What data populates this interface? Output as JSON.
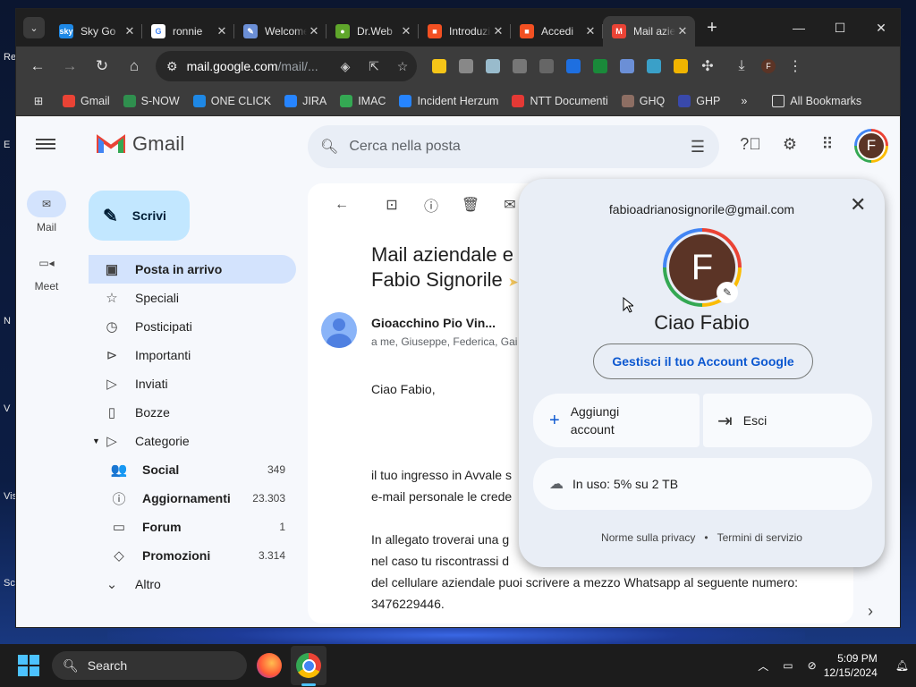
{
  "desktop": {
    "labels": [
      "Re",
      "E",
      "N",
      "V",
      "Vis",
      "Sc"
    ]
  },
  "browser": {
    "tabs": [
      {
        "title": "Sky Go",
        "fav_color": "#1e88e5",
        "fav_text": "sky"
      },
      {
        "title": "ronnie",
        "fav_color": "#ffffff",
        "fav_text": "G"
      },
      {
        "title": "Welcome",
        "fav_color": "#6b8fd6",
        "fav_text": "✎"
      },
      {
        "title": "Dr.Web",
        "fav_color": "#5fa62b",
        "fav_text": "●"
      },
      {
        "title": "Introduzione",
        "fav_color": "#f25022",
        "fav_text": "■"
      },
      {
        "title": "Accedi",
        "fav_color": "#f25022",
        "fav_text": "■"
      },
      {
        "title": "Mail aziendale",
        "fav_color": "#ea4335",
        "fav_text": "M"
      }
    ],
    "new_tab": "+",
    "url_host": "mail.google.com",
    "url_path": "/mail/...",
    "bookmarks": [
      {
        "label": "Gmail",
        "color": "#ea4335"
      },
      {
        "label": "S-NOW",
        "color": "#2f8f4e"
      },
      {
        "label": "ONE CLICK",
        "color": "#1e88e5"
      },
      {
        "label": "JIRA",
        "color": "#2684ff"
      },
      {
        "label": "IMAC",
        "color": "#34a853"
      },
      {
        "label": "Incident Herzum",
        "color": "#2684ff"
      },
      {
        "label": "NTT Documenti",
        "color": "#e53935"
      },
      {
        "label": "GHQ",
        "color": "#8d6e63"
      },
      {
        "label": "GHP",
        "color": "#3949ab"
      }
    ],
    "bookmarks_more": "»",
    "all_bookmarks": "All Bookmarks"
  },
  "gmail": {
    "logo_text": "Gmail",
    "search_placeholder": "Cerca nella posta",
    "avatar_letter": "F",
    "rail": [
      {
        "label": "Mail"
      },
      {
        "label": "Meet"
      }
    ],
    "compose": "Scrivi",
    "nav": [
      {
        "label": "Posta in arrivo",
        "icon": "▣"
      },
      {
        "label": "Speciali",
        "icon": "☆"
      },
      {
        "label": "Posticipati",
        "icon": "◷"
      },
      {
        "label": "Importanti",
        "icon": "⊳"
      },
      {
        "label": "Inviati",
        "icon": "▷"
      },
      {
        "label": "Bozze",
        "icon": "▯"
      },
      {
        "label": "Categorie",
        "icon": "▷"
      }
    ],
    "categories": [
      {
        "label": "Social",
        "count": "349",
        "icon": "👥"
      },
      {
        "label": "Aggiornamenti",
        "count": "23.303",
        "icon": "ⓘ"
      },
      {
        "label": "Forum",
        "count": "1",
        "icon": "▭"
      },
      {
        "label": "Promozioni",
        "count": "3.314",
        "icon": "◇"
      }
    ],
    "more": "Altro",
    "message": {
      "subject_line1": "Mail aziendale e c",
      "subject_line2": "Fabio Signorile",
      "sender": "Gioacchino Pio Vin...",
      "recipients": "a me, Giuseppe, Federica, Gai",
      "greeting": "Ciao Fabio,",
      "p1": "il tuo ingresso in Avvale s",
      "p1b": "e-mail personale le crede",
      "p2a": "In allegato troverai una g",
      "p2b": "nel caso tu riscontrassi d",
      "p2c": "del cellulare aziendale puoi scrivere a mezzo Whatsapp al seguente numero:",
      "p2d": "3476229446."
    }
  },
  "account_popup": {
    "email": "fabioadrianosignorile@gmail.com",
    "avatar_letter": "F",
    "greeting": "Ciao Fabio",
    "manage": "Gestisci il tuo Account Google",
    "add_account": "Aggiungi account",
    "sign_out": "Esci",
    "storage": "In uso: 5% su 2 TB",
    "privacy": "Norme sulla privacy",
    "separator": "•",
    "terms": "Termini di servizio"
  },
  "taskbar": {
    "search": "Search",
    "time": "5:09 PM",
    "date": "12/15/2024"
  }
}
